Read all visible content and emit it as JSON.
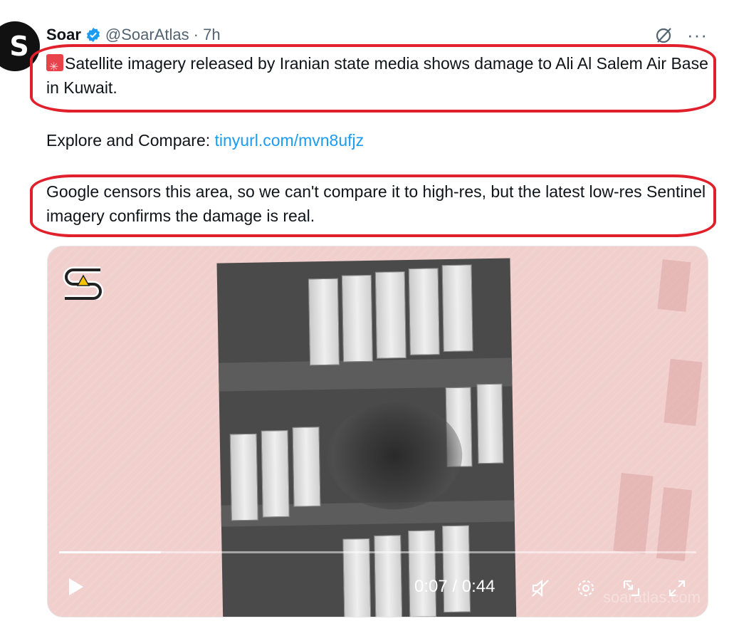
{
  "tweet": {
    "author_name": "Soar",
    "handle": "@SoarAtlas",
    "time": "· 7h",
    "line1": "Satellite imagery released by Iranian state media shows damage to Ali Al Salem Air Base in Kuwait.",
    "explore_label": "Explore and Compare: ",
    "explore_link": "tinyurl.com/mvn8ufjz",
    "line3": "Google censors this area, so we can't compare it to high-res, but the latest low-res Sentinel imagery confirms the damage is real."
  },
  "video": {
    "time": "0:07 / 0:44",
    "progress": 0.16,
    "watermark": "soaratlas.com"
  },
  "colors": {
    "link": "#1d9bf0",
    "annotation": "#e0202a",
    "verified": "#1d9bf0"
  }
}
